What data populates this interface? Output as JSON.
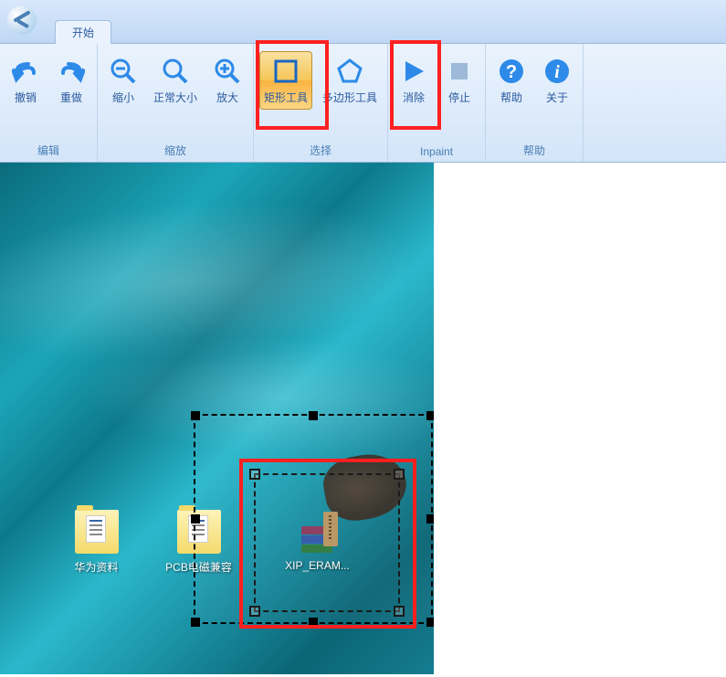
{
  "tabs": {
    "start": "开始"
  },
  "ribbon": {
    "edit": {
      "label": "编辑",
      "undo": "撤销",
      "redo": "重做"
    },
    "zoom": {
      "label": "缩放",
      "zoom_out": "缩小",
      "normal": "正常大小",
      "zoom_in": "放大"
    },
    "select": {
      "label": "选择",
      "rect_tool": "矩形工具",
      "polygon_tool": "多边形工具"
    },
    "inpaint": {
      "label": "Inpaint",
      "erase": "消除",
      "stop": "停止"
    },
    "help": {
      "label": "帮助",
      "help": "帮助",
      "about": "关于"
    }
  },
  "desktop": {
    "icon1": "华为资料",
    "icon2": "PCB电磁兼容",
    "icon3": "XIP_ERAM..."
  }
}
